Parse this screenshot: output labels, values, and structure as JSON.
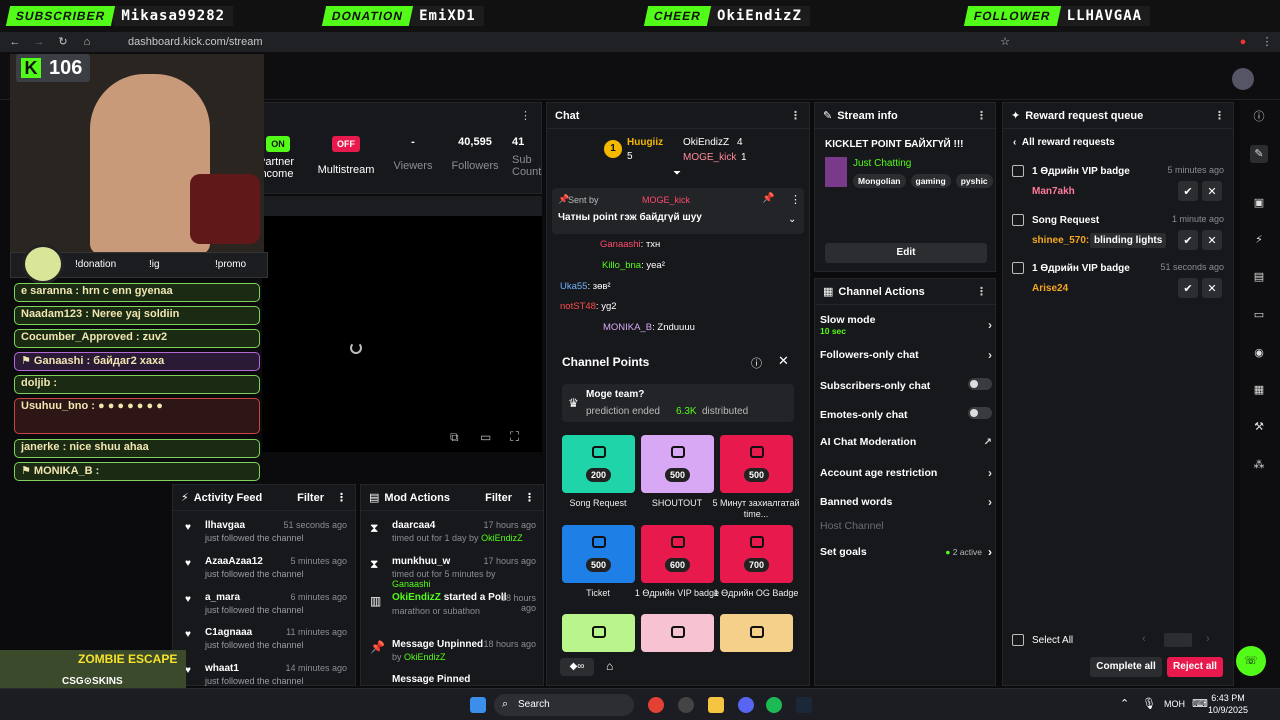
{
  "alerts": [
    {
      "tag": "SUBSCRIBER",
      "name": "Mikasa99282"
    },
    {
      "tag": "DONATION",
      "name": "EmiXD1"
    },
    {
      "tag": "CHEER",
      "name": "OkiEndizZ"
    },
    {
      "tag": "FOLLOWER",
      "name": "LLHAVGAA"
    }
  ],
  "browser": {
    "url": "dashboard.kick.com/stream"
  },
  "overlay": {
    "kick_count": "106",
    "commands": [
      "!donation",
      "!ig",
      "!promo"
    ],
    "sponsor": "CSG⊙SKINS",
    "game_banner": "ZOMBIE ESCAPE"
  },
  "overlay_chat": [
    {
      "user": "e saranna",
      "msg": "hrn c enn gyenaa"
    },
    {
      "user": "Naadam123",
      "msg": "Neree yaj soldiin"
    },
    {
      "user": "Cocumber_Approved",
      "msg": "zuv2"
    },
    {
      "user": "Ganaashi",
      "msg": "байдаг2 хаха"
    },
    {
      "user": "doljib",
      "msg": ""
    },
    {
      "user": "Usuhuu_bno",
      "msg": ""
    },
    {
      "user": "janerke",
      "msg": "nice shuu ahaa"
    },
    {
      "user": "MONIKA_B",
      "msg": ""
    }
  ],
  "stats": [
    {
      "value": "ON",
      "label": "Partner income"
    },
    {
      "value": "OFF",
      "label": "Multistream"
    },
    {
      "value": "-",
      "label": "Viewers"
    },
    {
      "value": "40,595",
      "label": "Followers"
    },
    {
      "value": "41",
      "label": "Sub Count"
    }
  ],
  "chat": {
    "title": "Chat",
    "leaders": [
      {
        "rank": "1",
        "name": "Huugiiz",
        "count": "5"
      },
      {
        "name": "OkiEndizZ",
        "count": "4"
      },
      {
        "name": "MOGE_kick",
        "count": "1"
      }
    ],
    "pinned_by_label": "Sent by",
    "pinned_by": "MOGE_kick",
    "pinned_text": "Чатны point гэж байдгүй шуу",
    "messages": [
      {
        "user": "Ganaashi",
        "text": "тхн"
      },
      {
        "user": "Killo_bna",
        "text": "yea²"
      },
      {
        "user": "Uka55",
        "text": "зөв²"
      },
      {
        "user": "notST48",
        "text": "yg2"
      },
      {
        "user": "MONIKA_B",
        "text": "Znduuuu"
      }
    ]
  },
  "channel_points": {
    "title": "Channel Points",
    "prediction_title": "Moge team?",
    "prediction_status": "prediction ended",
    "prediction_amount": "6.3K",
    "prediction_suffix": "distributed",
    "rewards": [
      {
        "cost": "200",
        "label": "Song Request",
        "color": "#1fd4a8"
      },
      {
        "cost": "500",
        "label": "SHOUTOUT",
        "color": "#d9a8f5"
      },
      {
        "cost": "500",
        "label": "5 Минут захиалгатай time...",
        "color": "#e8194c"
      },
      {
        "cost": "500",
        "label": "Ticket",
        "color": "#1e7fe6"
      },
      {
        "cost": "600",
        "label": "1 Өдрийн VIP badge",
        "color": "#e8194c"
      },
      {
        "cost": "700",
        "label": "1 Өдрийн OG Badge",
        "color": "#e8194c"
      },
      {
        "cost": "",
        "label": "",
        "color": "#b9f58a"
      },
      {
        "cost": "",
        "label": "",
        "color": "#f7c3d3"
      },
      {
        "cost": "",
        "label": "",
        "color": "#f5d08a"
      }
    ]
  },
  "stream_info": {
    "title": "Stream info",
    "stream_title": "KICKLET POINT БАЙХГҮЙ !!!",
    "category": "Just Chatting",
    "tags": [
      "Mongolian",
      "gaming",
      "pyshic"
    ],
    "edit": "Edit"
  },
  "channel_actions": {
    "title": "Channel Actions",
    "items": [
      {
        "label": "Slow mode",
        "sub": "10 sec",
        "control": "arrow"
      },
      {
        "label": "Followers-only chat",
        "control": "arrow"
      },
      {
        "label": "Subscribers-only chat",
        "control": "toggle"
      },
      {
        "label": "Emotes-only chat",
        "control": "toggle"
      },
      {
        "label": "AI Chat Moderation",
        "control": "external"
      },
      {
        "label": "Account age restriction",
        "control": "arrow"
      },
      {
        "label": "Banned words",
        "control": "arrow"
      },
      {
        "label": "Host Channel",
        "control": "none"
      },
      {
        "label": "Set goals",
        "status": "2 active",
        "control": "arrow"
      }
    ]
  },
  "reward_queue": {
    "title": "Reward request queue",
    "back": "All reward requests",
    "requests": [
      {
        "reward": "1 Өдрийн VIP badge",
        "time": "5 minutes ago",
        "user": "Man7akh",
        "user_color": "#ff7a9a",
        "input": ""
      },
      {
        "reward": "Song Request",
        "time": "1 minute ago",
        "user": "shinee_570:",
        "user_color": "#f5a623",
        "input": "blinding lights"
      },
      {
        "reward": "1 Өдрийн VIP badge",
        "time": "51 seconds ago",
        "user": "Arise24",
        "user_color": "#f5a623",
        "input": ""
      }
    ],
    "select_all": "Select All",
    "complete_all": "Complete all",
    "reject_all": "Reject all"
  },
  "activity": {
    "title": "Activity Feed",
    "filter": "Filter",
    "items": [
      {
        "user": "llhavgaa",
        "action": "just followed the channel",
        "time": "51 seconds ago"
      },
      {
        "user": "AzaaAzaa12",
        "action": "just followed the channel",
        "time": "5 minutes ago"
      },
      {
        "user": "a_mara",
        "action": "just followed the channel",
        "time": "6 minutes ago"
      },
      {
        "user": "C1agnaaa",
        "action": "just followed the channel",
        "time": "11 minutes ago"
      },
      {
        "user": "whaat1",
        "action": "just followed the channel",
        "time": "14 minutes ago"
      }
    ]
  },
  "mod_actions": {
    "title": "Mod Actions",
    "filter": "Filter",
    "items": [
      {
        "user": "daarcaa4",
        "text": "timed out for 1 day by",
        "by": "OkiEndizZ",
        "time": "17 hours ago"
      },
      {
        "user": "munkhuu_w",
        "text": "timed out for 5 minutes by",
        "by": "Ganaashi",
        "time": "17 hours ago"
      },
      {
        "user": "OkiEndizZ",
        "text": "started a Poll",
        "sub": "marathon or subathon",
        "time": "18 hours ago"
      },
      {
        "user": "Message Unpinned",
        "text": "by",
        "by": "OkiEndizZ",
        "time": "18 hours ago"
      },
      {
        "user": "Message Pinned",
        "text": "",
        "time": ""
      }
    ]
  },
  "taskbar": {
    "search": "Search",
    "lang": "МОН",
    "time": "6:43 PM",
    "date": "10/9/2025"
  },
  "colors": {
    "accent": "#53fc18",
    "reject": "#e8194c",
    "panel": "#17181b"
  }
}
